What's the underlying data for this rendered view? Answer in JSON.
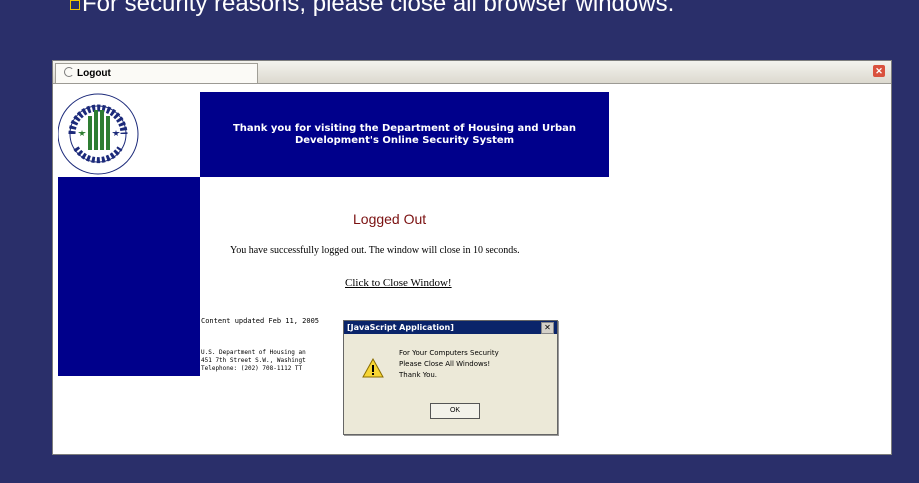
{
  "slide": {
    "bullet_text": "For security reasons, please close all browser windows."
  },
  "browser": {
    "tab_title": "Logout"
  },
  "page": {
    "header_text": "Thank you for visiting the Department of Housing and Urban Development's Online Security System",
    "logged_out_title": "Logged Out",
    "message": "You have successfully logged out. The window will close in 10 seconds.",
    "close_link": "Click to Close Window!",
    "content_updated": "Content updated Feb 11, 2005",
    "address_lines": "U.S. Department of Housing an\n451 7th Street S.W., Washingt\nTelephone: (202) 708-1112 TT",
    "logo_text": "U.S. DEPARTMENT OF HOUSING AND URBAN DEVELOPMENT"
  },
  "alert": {
    "title": "[JavaScript Application]",
    "line1": "For Your Computers Security",
    "line2": "Please Close All Windows!",
    "line3": "Thank You.",
    "ok_label": "OK"
  },
  "colors": {
    "slide_bg": "#2a2f6a",
    "hud_blue": "#00008b",
    "title_red": "#7b1111"
  }
}
